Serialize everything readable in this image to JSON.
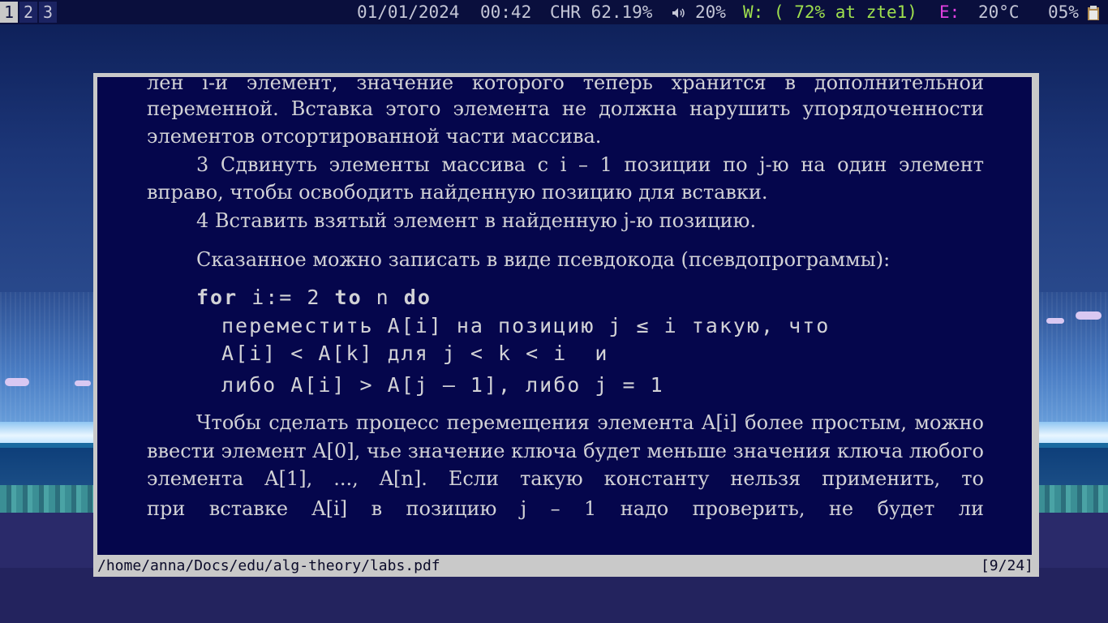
{
  "status_bar": {
    "workspaces": [
      {
        "label": "1",
        "active": true
      },
      {
        "label": "2",
        "active": false
      },
      {
        "label": "3",
        "active": false
      }
    ],
    "date": "01/01/2024",
    "time": "00:42",
    "battery": "CHR 62.19%",
    "volume_icon": "speaker-icon",
    "volume": "20%",
    "wifi": "W: ( 72% at zte1)",
    "ethernet_label": "E:",
    "temperature": "20°C",
    "cpu": "05%",
    "clipboard_icon": "clipboard-icon",
    "colors": {
      "background": "#0a0f3d",
      "wifi": "#9fe04e",
      "ethernet": "#e040e0",
      "text": "#c4c6d6"
    }
  },
  "viewer": {
    "file_path": "/home/anna/Docs/edu/alg-theory/labs.pdf",
    "page_indicator": "[9/24]",
    "colors": {
      "page_bg": "#05064c",
      "text": "#d2d2d6",
      "frame": "#c9c9c9"
    },
    "content": {
      "partial_line": "лен i-й элемент, значение которого теперь хранится в дополнительной",
      "para1_line2": "переменной. Вставка этого элемента не должна нарушить упорядоченности",
      "para1_line3": "элементов отсортированной части массива.",
      "step3_line1": "3 Сдвинуть элементы массива с i – 1 позиции по j-ю на один элемент",
      "step3_line2": "вправо, чтобы освободить найденную позицию для вставки.",
      "step4": "4 Вставить взятый элемент в найденную j-ю позицию.",
      "pseudo_intro": "Сказанное можно записать в виде псевдокода (псевдопрограммы):",
      "code": {
        "kw_for": "for",
        "loop_var": " i:= 2 ",
        "kw_to": "to",
        "loop_end": " n ",
        "kw_do": "do",
        "line2": "переместить A[i] на позицию j ≤ i такую, что",
        "line3": "A[i] < A[k] для j < k < i  и",
        "line4": "либо A[i] > A[j – 1], либо j = 1"
      },
      "para2_line1": "Чтобы сделать процесс перемещения элемента A[i] более простым, можно",
      "para2_line2": "ввести элемент A[0], чье значение ключа будет меньше значения ключа любого",
      "para2_line3": "элемента A[1], ..., A[n]. Если такую константу нельзя применить, то",
      "para2_line4": "при вставке A[i] в позицию j – 1 надо проверить, не будет ли"
    }
  }
}
